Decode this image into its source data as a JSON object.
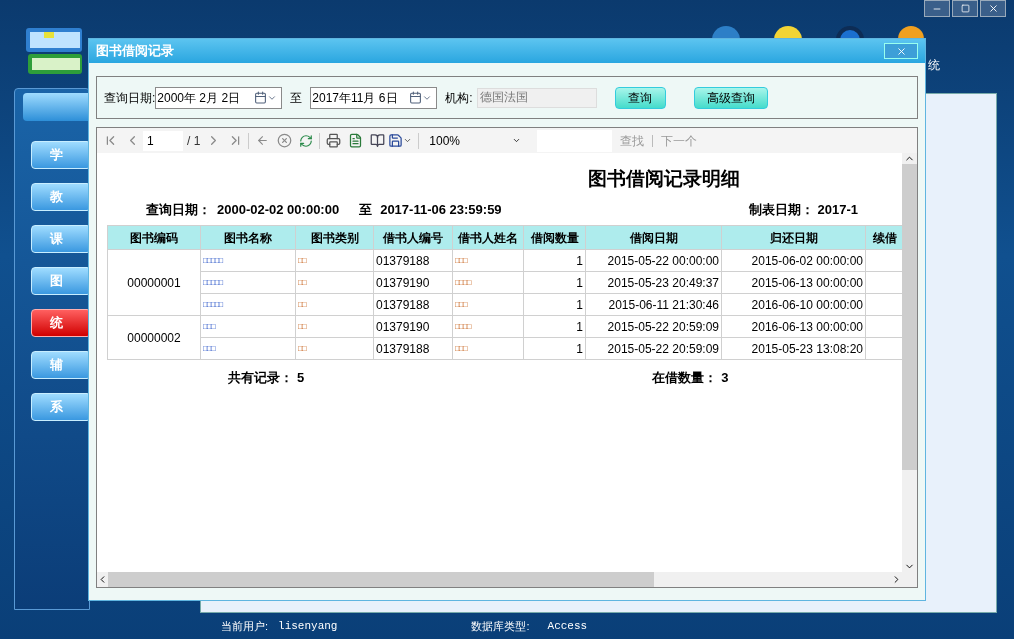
{
  "sidebar": {
    "items": [
      {
        "label": "学",
        "selected": false
      },
      {
        "label": "教",
        "selected": false
      },
      {
        "label": "课",
        "selected": false
      },
      {
        "label": "图",
        "selected": false
      },
      {
        "label": "统",
        "selected": true
      },
      {
        "label": "辅",
        "selected": false
      },
      {
        "label": "系",
        "selected": false
      }
    ]
  },
  "toolbar_label": "统",
  "dialog": {
    "title": "图书借阅记录",
    "query": {
      "date_label": "查询日期:",
      "from": "2000年 2月 2日",
      "to_label": "至",
      "to": "2017年11月 6日",
      "org_label": "机构:",
      "org_value": "德国法国",
      "buttons": [
        "查询",
        "高级查询"
      ]
    },
    "viewer": {
      "page": "1",
      "page_total": "/ 1",
      "zoom": "100%",
      "find": "查找",
      "find_next": "下一个",
      "report": {
        "title": "图书借阅记录明细",
        "range_label": "查询日期：",
        "from": "2000-02-02 00:00:00",
        "to_label": "至",
        "to": "2017-11-06 23:59:59",
        "made_label": "制表日期：",
        "made": "2017-1",
        "columns": [
          "图书编码",
          "图书名称",
          "图书类别",
          "借书人编号",
          "借书人姓名",
          "借阅数量",
          "借阅日期",
          "归还日期",
          "续借"
        ],
        "groups": [
          {
            "code": "00000001",
            "rows": [
              {
                "name": "□□□□□",
                "category": "□□",
                "borrower_id": "01379188",
                "borrower": "□□□",
                "count": "1",
                "borrowed": "2015-05-22 00:00:00",
                "returned": "2015-06-02 00:00:00"
              },
              {
                "name": "□□□□□",
                "category": "□□",
                "borrower_id": "01379190",
                "borrower": "□□□□",
                "count": "1",
                "borrowed": "2015-05-23 20:49:37",
                "returned": "2015-06-13 00:00:00"
              },
              {
                "name": "□□□□□",
                "category": "□□",
                "borrower_id": "01379188",
                "borrower": "□□□",
                "count": "1",
                "borrowed": "2015-06-11 21:30:46",
                "returned": "2016-06-10 00:00:00"
              }
            ]
          },
          {
            "code": "00000002",
            "rows": [
              {
                "name": "□□□",
                "category": "□□",
                "borrower_id": "01379190",
                "borrower": "□□□□",
                "count": "1",
                "borrowed": "2015-05-22 20:59:09",
                "returned": "2016-06-13 00:00:00"
              },
              {
                "name": "□□□",
                "category": "□□",
                "borrower_id": "01379188",
                "borrower": "□□□",
                "count": "1",
                "borrowed": "2015-05-22 20:59:09",
                "returned": "2015-05-23 13:08:20"
              }
            ]
          }
        ],
        "total_label": "共有记录：",
        "total": "5",
        "on_loan_label": "在借数量：",
        "on_loan": "3"
      }
    }
  },
  "status_bar": {
    "user_label": "当前用户:",
    "user": "lisenyang",
    "db_label": "数据库类型:",
    "db": "Access"
  }
}
